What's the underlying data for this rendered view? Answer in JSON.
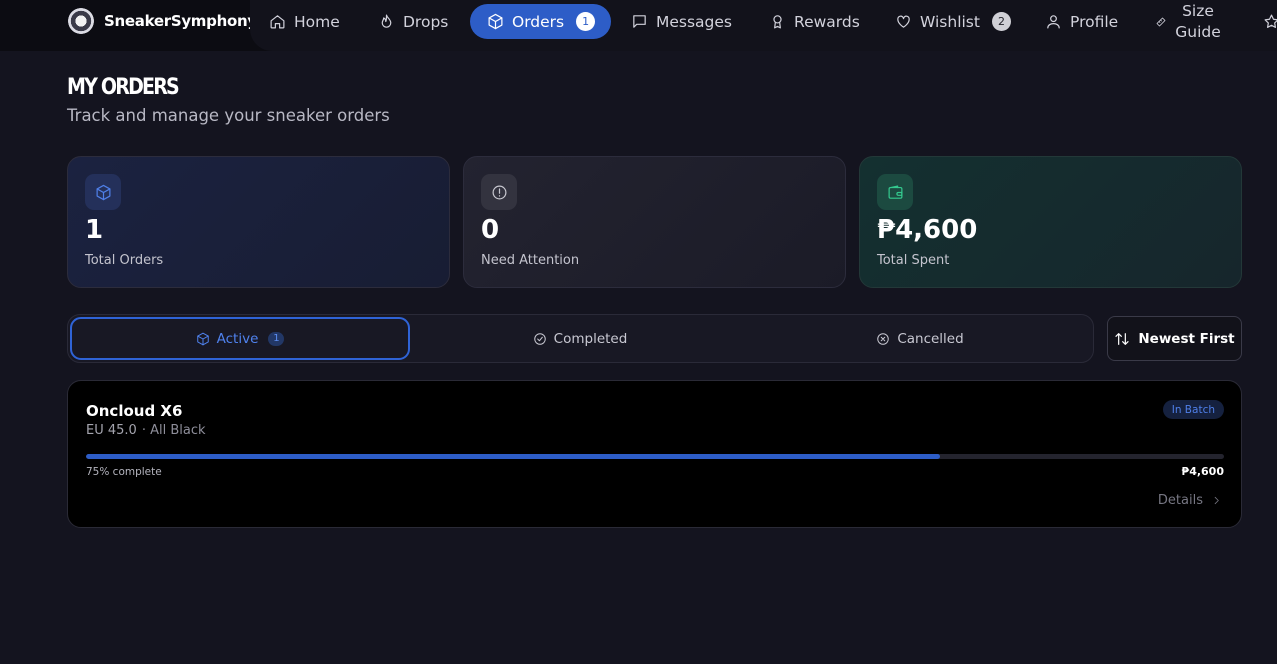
{
  "brand": {
    "name": "SneakerSymphony",
    "logo": "vinyl-sneaker-logo"
  },
  "nav": {
    "home": "Home",
    "drops": "Drops",
    "orders": "Orders",
    "orders_badge": "1",
    "messages": "Messages",
    "rewards": "Rewards",
    "wishlist": "Wishlist",
    "wishlist_badge": "2",
    "profile": "Profile",
    "size_guide_line1": "Size",
    "size_guide_line2": "Guide",
    "active": "orders",
    "accent": "#2d5dc7"
  },
  "header": {
    "title": "MY ORDERS",
    "subtitle": "Track and manage your sneaker orders"
  },
  "stats": [
    {
      "value": "1",
      "label": "Total Orders",
      "icon": "package-icon",
      "color": "#4f7fe8"
    },
    {
      "value": "0",
      "label": "Need Attention",
      "icon": "alert-circle-icon",
      "color": "#c8c8d0"
    },
    {
      "value": "₱4,600",
      "label": "Total Spent",
      "icon": "wallet-icon",
      "color": "#34c98e"
    }
  ],
  "tabs": {
    "active": "Active",
    "active_count": "1",
    "completed": "Completed",
    "cancelled": "Cancelled"
  },
  "sort": {
    "label": "Newest First",
    "icon": "sort-arrows-icon"
  },
  "orders": [
    {
      "name": "Oncloud X6",
      "size": "EU 45.0",
      "colorway": "· All Black",
      "status": "In Batch",
      "progress": 0.75,
      "progress_label": "75% complete",
      "price": "₱4,600",
      "details_label": "Details"
    }
  ]
}
